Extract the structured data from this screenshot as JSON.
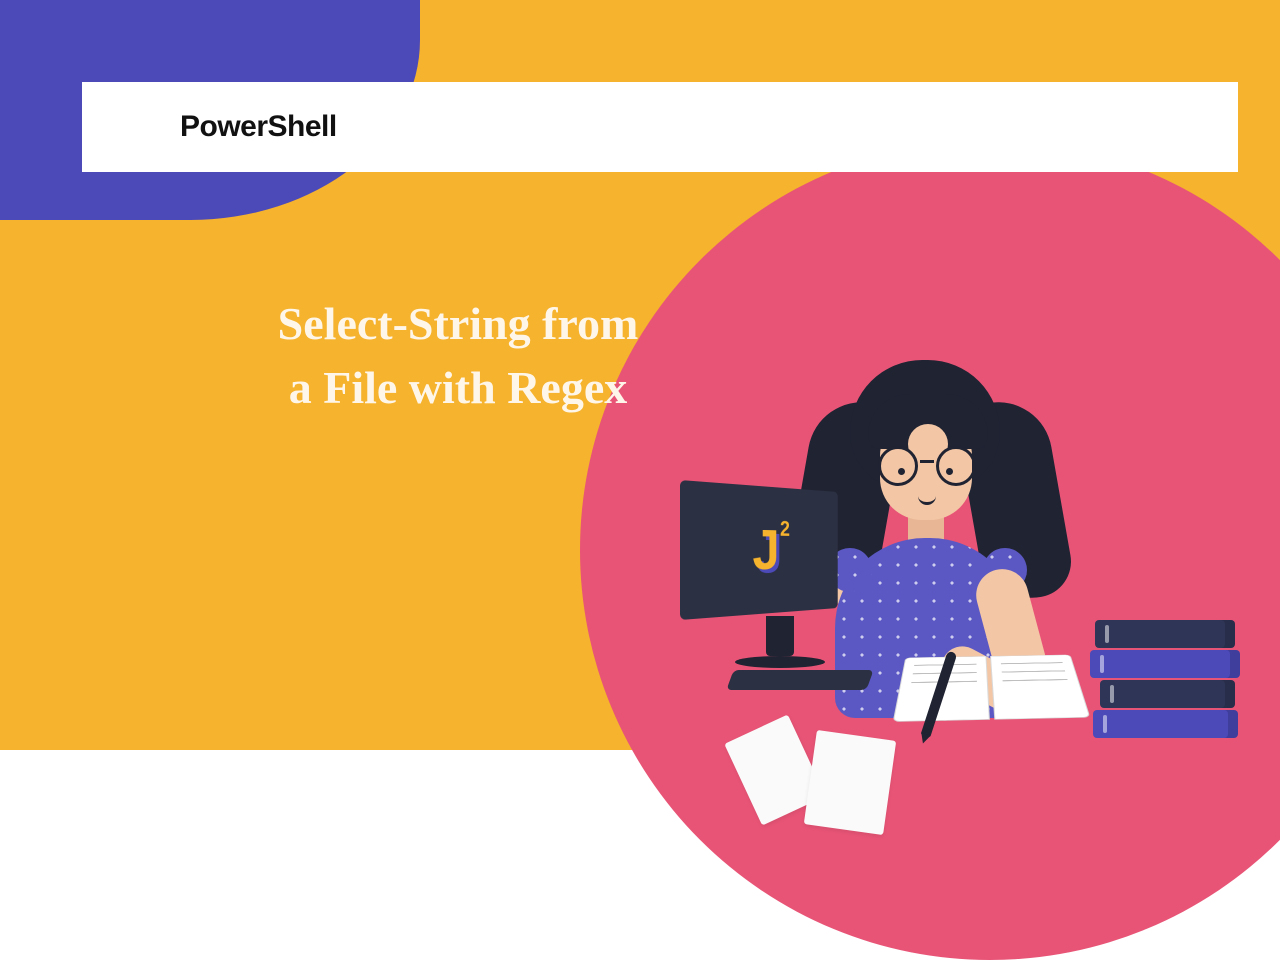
{
  "header": {
    "label": "PowerShell"
  },
  "title": {
    "line1": "Select-String from",
    "line2": "a File with Regex"
  },
  "logo": {
    "letter": "J",
    "sup": "2"
  },
  "colors": {
    "background": "#f5b32e",
    "accent_blue": "#4c49b8",
    "accent_pink": "#e85476",
    "text_dark": "#111111",
    "text_light": "#fff6ea"
  }
}
